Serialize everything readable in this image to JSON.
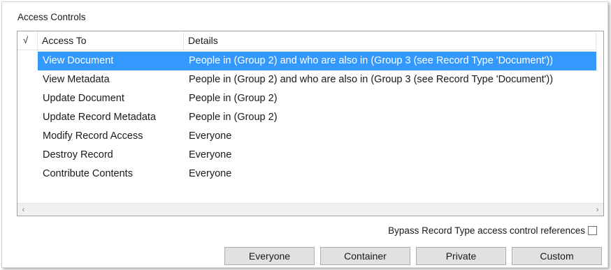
{
  "section_title": "Access Controls",
  "list": {
    "columns": {
      "check": "√",
      "access_to": "Access To",
      "details": "Details"
    },
    "rows": [
      {
        "access_to": "View Document",
        "details": "People in (Group 2) and who are also in (Group 3 (see Record Type 'Document'))",
        "selected": true
      },
      {
        "access_to": "View Metadata",
        "details": "People in (Group 2) and who are also in (Group 3 (see Record Type 'Document'))",
        "selected": false
      },
      {
        "access_to": "Update Document",
        "details": "People in (Group 2)",
        "selected": false
      },
      {
        "access_to": "Update Record Metadata",
        "details": "People in (Group 2)",
        "selected": false
      },
      {
        "access_to": "Modify Record Access",
        "details": "Everyone",
        "selected": false
      },
      {
        "access_to": "Destroy Record",
        "details": "Everyone",
        "selected": false
      },
      {
        "access_to": "Contribute Contents",
        "details": "Everyone",
        "selected": false
      }
    ],
    "scroll_left_icon": "chevron-left-icon",
    "scroll_right_icon": "chevron-right-icon"
  },
  "bypass": {
    "label": "Bypass Record Type access control references",
    "checked": false
  },
  "buttons": {
    "everyone": "Everyone",
    "container": "Container",
    "private": "Private",
    "custom": "Custom"
  },
  "colors": {
    "selection": "#3399ff",
    "button_face": "#e1e1e1",
    "border": "#a0a0a0"
  }
}
